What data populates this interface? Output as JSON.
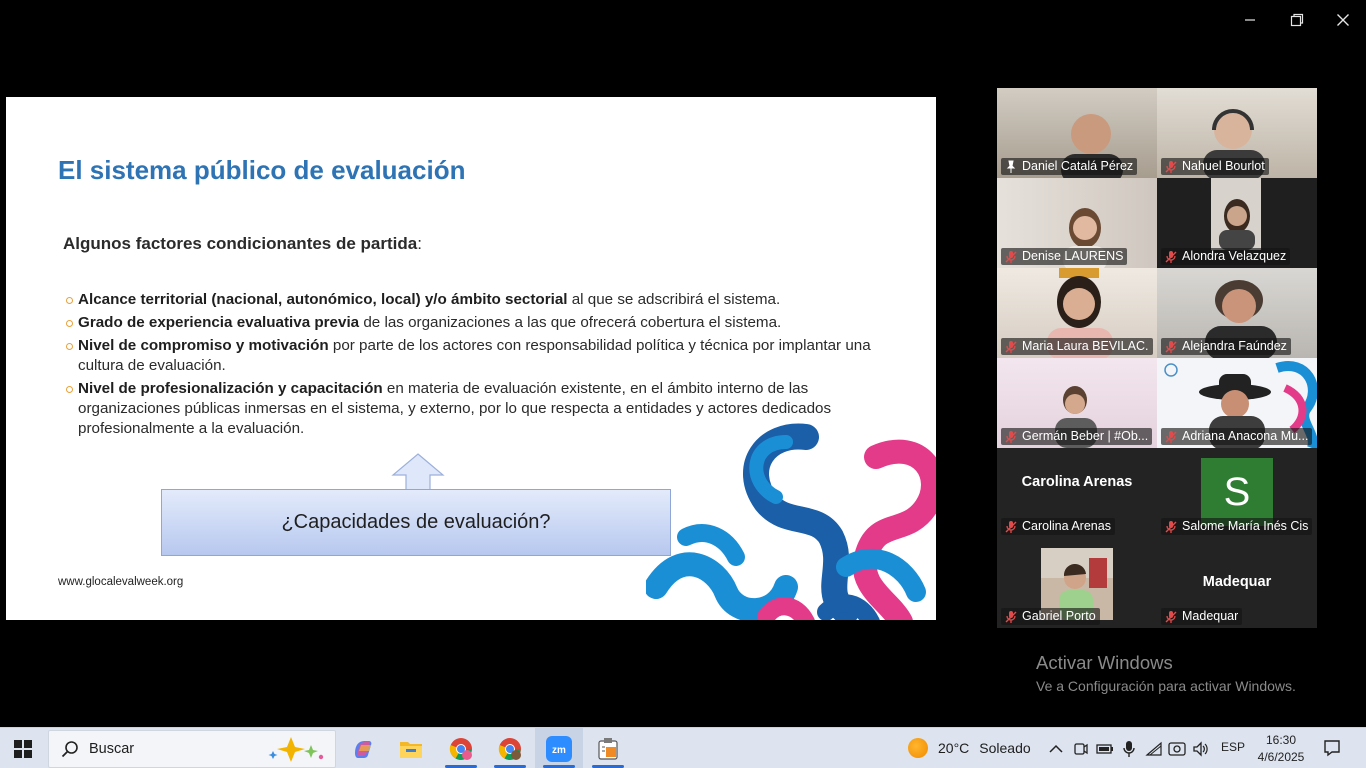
{
  "window": {
    "controls": {
      "minimize": "minimize-icon",
      "restore": "restore-icon",
      "close": "close-icon"
    }
  },
  "slide": {
    "title": "El sistema público de evaluación",
    "subtitle_bold": "Algunos factores condicionantes de partida",
    "subtitle_colon": ":",
    "bullets": [
      {
        "bold": "Alcance territorial (nacional, autonómico, local) y/o ámbito sectorial",
        "rest": " al que se adscribirá el sistema."
      },
      {
        "bold": "Grado de experiencia evaluativa previa",
        "rest": " de las organizaciones a las que ofrecerá cobertura el sistema."
      },
      {
        "bold": "Nivel de compromiso y motivación",
        "rest": " por parte de los actores con responsabilidad política y técnica por implantar una cultura de evaluación."
      },
      {
        "bold": "Nivel de profesionalización y capacitación",
        "rest": " en materia de evaluación existente, en el ámbito interno de las organizaciones públicas inmersas en el sistema, y externo, por lo que respecta a entidades y actores dedicados profesionalmente a la evaluación."
      }
    ],
    "box_text": "¿Capacidades de evaluación?",
    "url": "www.glocalevalweek.org",
    "colors": {
      "title": "#2e74b5",
      "bullet": "#e8a23a",
      "deco_blue": "#1b8fd6",
      "deco_pink": "#e33a8a",
      "deco_dark": "#1a5fa8"
    }
  },
  "participants": [
    {
      "name": "Daniel Catalá Pérez",
      "icon": "pin-icon",
      "active": true,
      "bg": "#b9b2a7"
    },
    {
      "name": "Nahuel Bourlot",
      "icon": "muted-mic-icon",
      "bg": "#cfc9c0"
    },
    {
      "name": "Denise LAURENS",
      "icon": "muted-mic-icon",
      "bg": "#d9d3cc"
    },
    {
      "name": "Alondra Velazquez",
      "icon": "muted-mic-icon",
      "bg": "#1f1f1f"
    },
    {
      "name": "Maria Laura BEVILAC...",
      "icon": "muted-mic-icon",
      "bg": "#e3ddd6"
    },
    {
      "name": "Alejandra Faúndez",
      "icon": "muted-mic-icon",
      "bg": "#c9c7c4"
    },
    {
      "name": "Germán Beber | #Ob...",
      "icon": "muted-mic-icon",
      "bg": "#eddde8"
    },
    {
      "name": "Adriana Anacona Mu...",
      "icon": "muted-mic-icon",
      "bg": "#f2f4f7"
    },
    {
      "name": "Carolina Arenas",
      "icon": "muted-mic-icon",
      "display": "Carolina Arenas",
      "bg": "#232323"
    },
    {
      "name": "Salome María Inés Cis",
      "icon": "muted-mic-icon",
      "avatar_letter": "S",
      "bg": "#232323"
    },
    {
      "name": "Gabriel Porto",
      "icon": "muted-mic-icon",
      "bg": "#232323"
    },
    {
      "name": "Madequar",
      "icon": "muted-mic-icon",
      "display": "Madequar",
      "bg": "#232323"
    }
  ],
  "activation": {
    "line1": "Activar Windows",
    "line2": "Ve a Configuración para activar Windows."
  },
  "taskbar": {
    "search_placeholder": "Buscar",
    "apps": [
      "copilot-icon",
      "file-explorer-icon",
      "chrome-icon",
      "chrome-profile-icon",
      "zoom-icon",
      "notepad-icon"
    ],
    "weather_temp": "20°C",
    "weather_cond": "Soleado",
    "lang": "ESP",
    "time": "16:30",
    "date": "4/6/2025"
  }
}
